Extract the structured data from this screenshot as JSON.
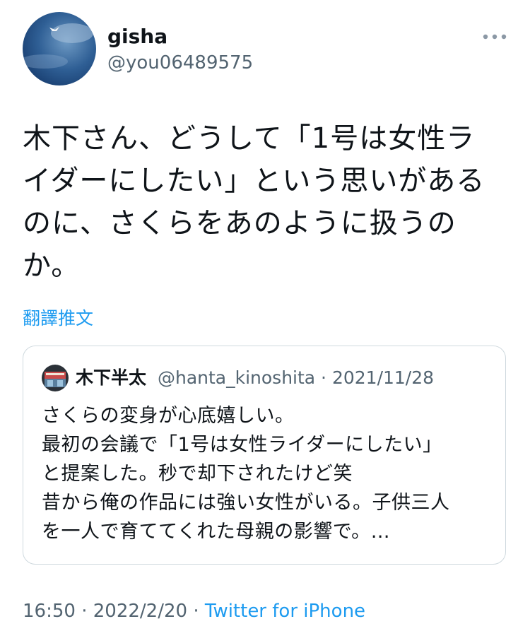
{
  "author": {
    "name": "gisha",
    "handle": "@you06489575",
    "avatar_icon": "sky-with-bird-avatar"
  },
  "more_icon": "more-horizontal-icon",
  "tweet": {
    "lines": [
      "木下さん、どうして「1号は女性ラ",
      "イダーにしたい」という思いがある",
      "のに、さくらをあのように扱うの",
      "か。"
    ]
  },
  "translate_label": "翻譯推文",
  "quoted": {
    "name": "木下半太",
    "handle": "@hanta_kinoshita",
    "separator": " · ",
    "date": "2021/11/28",
    "lines": [
      "さくらの変身が心底嬉しい。",
      "最初の会議で「1号は女性ライダーにしたい」",
      "と提案した。秒で却下されたけど笑",
      "昔から俺の作品には強い女性がいる。子供三人",
      "を一人で育ててくれた母親の影響で。…"
    ]
  },
  "footer": {
    "time": "16:50",
    "separator": " · ",
    "date": "2022/2/20",
    "source": "Twitter for iPhone"
  },
  "colors": {
    "link": "#1d9bf0",
    "muted": "#536471",
    "text": "#0f1419",
    "border": "#cfd9de"
  }
}
